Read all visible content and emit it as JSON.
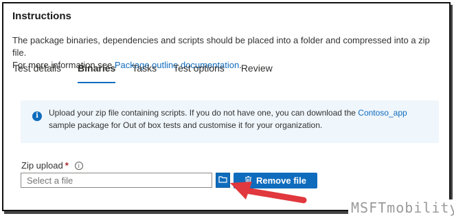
{
  "title": "Instructions",
  "description": {
    "line1": "The package binaries, dependencies and scripts should be placed into a folder and compressed into a zip file.",
    "line2_prefix": "For more information see ",
    "link": "Package outline documentation",
    "line2_suffix": "."
  },
  "tabs": [
    {
      "label": "Test details",
      "active": false
    },
    {
      "label": "Binaries",
      "active": true
    },
    {
      "label": "Tasks",
      "active": false
    },
    {
      "label": "Test options",
      "active": false
    },
    {
      "label": "Review",
      "active": false
    }
  ],
  "info": {
    "icon": "info-icon",
    "text_prefix": "Upload your zip file containing scripts. If you do not have one, you can download the ",
    "link": "Contoso_app",
    "text_suffix": " sample package for Out of box tests and customise it for your organization."
  },
  "zip_upload": {
    "label": "Zip upload",
    "required_marker": "*",
    "placeholder": "Select a file",
    "browse_icon": "folder-icon",
    "remove_label": "Remove file",
    "remove_icon": "trash-icon"
  },
  "watermark": "MSFTmobility",
  "colors": {
    "accent": "#0f6cbd",
    "info_background": "#eff6fc",
    "arrow": "#e0383e"
  }
}
